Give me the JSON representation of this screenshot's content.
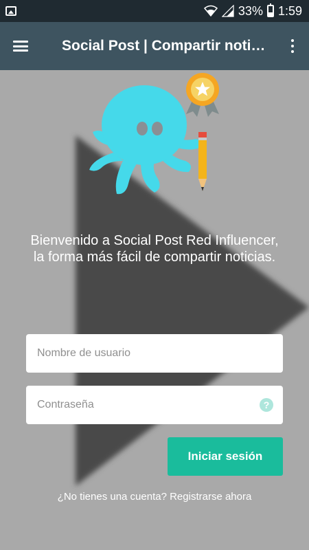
{
  "status_bar": {
    "battery": "33%",
    "time": "1:59",
    "icons": [
      "gallery-icon",
      "wifi-icon",
      "signal-icon",
      "battery-icon"
    ]
  },
  "app_bar": {
    "title": "Social Post | Compartir noti…",
    "menu_icon": "hamburger-menu-icon",
    "overflow_icon": "more-vert-icon"
  },
  "welcome": {
    "line1": "Bienvenido a Social Post Red Influencer,",
    "line2": "la forma más fácil de compartir noticias."
  },
  "form": {
    "username_placeholder": "Nombre de usuario",
    "password_placeholder": "Contraseña",
    "help_icon": "help-icon",
    "login_label": "Iniciar sesión",
    "register_text": "¿No tienes una cuenta? Registrarse ahora"
  },
  "colors": {
    "status_bar": "#1f2a31",
    "app_bar": "#3e5460",
    "background": "#a9a9a9",
    "accent": "#1abc9c",
    "mascot": "#45d9ea"
  }
}
